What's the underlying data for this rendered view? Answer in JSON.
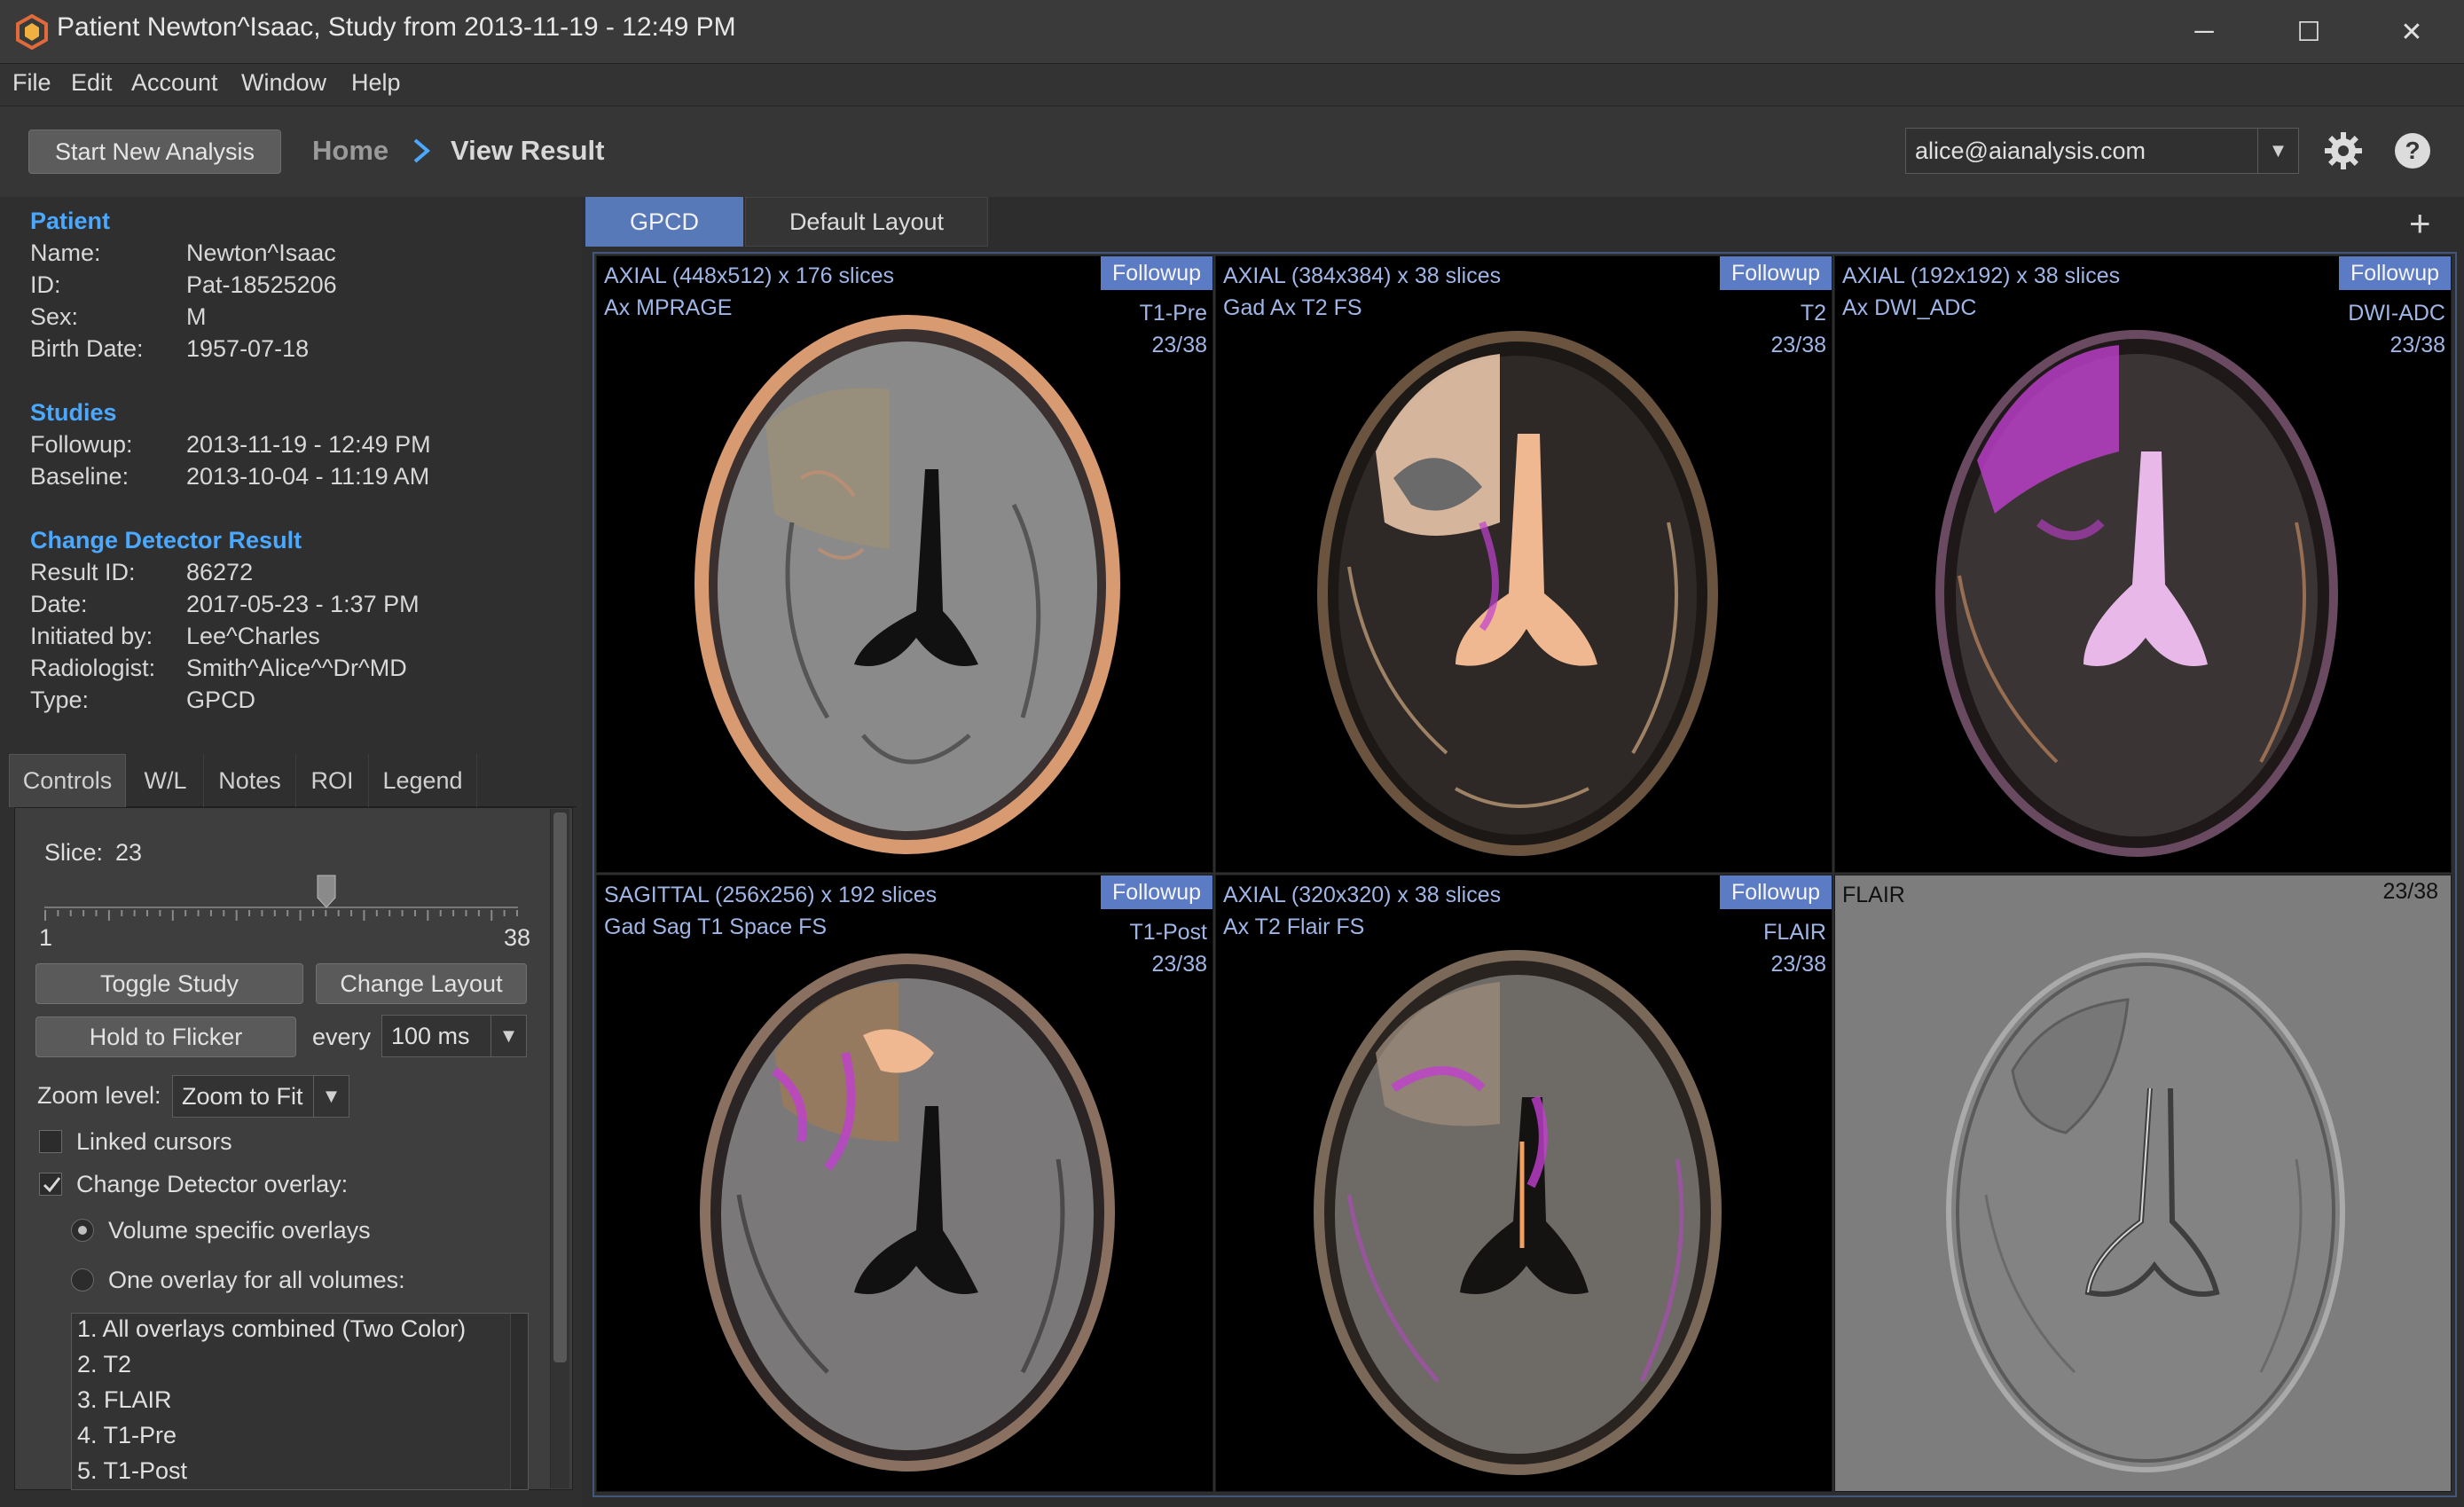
{
  "window": {
    "title": "Patient Newton^Isaac, Study from 2013-11-19 - 12:49 PM",
    "minimize": "─",
    "maximize": "☐",
    "close": "✕"
  },
  "menu": [
    "File",
    "Edit",
    "Account",
    "Window",
    "Help"
  ],
  "toolbar": {
    "start_label": "Start New Analysis",
    "breadcrumb": [
      "Home",
      "View Result"
    ],
    "user": "alice@aianalysis.com"
  },
  "patient": {
    "heading": "Patient",
    "fields": [
      {
        "k": "Name:",
        "v": "Newton^Isaac"
      },
      {
        "k": "ID:",
        "v": "Pat-18525206"
      },
      {
        "k": "Sex:",
        "v": "M"
      },
      {
        "k": "Birth Date:",
        "v": "1957-07-18"
      }
    ]
  },
  "studies": {
    "heading": "Studies",
    "fields": [
      {
        "k": "Followup:",
        "v": "2013-11-19 - 12:49 PM"
      },
      {
        "k": "Baseline:",
        "v": "2013-10-04 - 11:19 AM"
      }
    ]
  },
  "result": {
    "heading": "Change Detector Result",
    "fields": [
      {
        "k": "Result ID:",
        "v": "86272"
      },
      {
        "k": "Date:",
        "v": "2017-05-23 - 1:37 PM"
      },
      {
        "k": "Initiated by:",
        "v": "Lee^Charles"
      },
      {
        "k": "Radiologist:",
        "v": "Smith^Alice^^Dr^MD"
      },
      {
        "k": "Type:",
        "v": "GPCD"
      }
    ]
  },
  "control_tabs": [
    "Controls",
    "W/L",
    "Notes",
    "ROI",
    "Legend"
  ],
  "controls": {
    "slice_label": "Slice:",
    "slice_value": "23",
    "slice_min": "1",
    "slice_max": "38",
    "slice_fraction": 0.595,
    "toggle_study": "Toggle Study",
    "change_layout": "Change Layout",
    "hold_flicker": "Hold to Flicker",
    "every": "every",
    "interval": "100 ms",
    "zoom_label": "Zoom level:",
    "zoom_value": "Zoom to Fit",
    "linked_cursors": "Linked cursors",
    "linked_cursors_checked": false,
    "overlay_label": "Change Detector overlay:",
    "overlay_checked": true,
    "radio_volume": "Volume specific overlays",
    "radio_one": "One overlay for all volumes:",
    "overlay_list": [
      "1. All overlays combined (Two Color)",
      "2. T2",
      "3. FLAIR",
      "4. T1-Pre",
      "5. T1-Post"
    ]
  },
  "view_tabs": [
    "GPCD",
    "Default Layout"
  ],
  "add_tab": "+",
  "viewports": [
    {
      "line1": "AXIAL (448x512) x 176 slices",
      "line2": "Ax MPRAGE",
      "badge": "Followup",
      "seq": "T1-Pre",
      "slice": "23/38"
    },
    {
      "line1": "AXIAL (384x384) x 38 slices",
      "line2": "Gad Ax T2 FS",
      "badge": "Followup",
      "seq": "T2",
      "slice": "23/38"
    },
    {
      "line1": "AXIAL (192x192) x 38 slices",
      "line2": "Ax DWI_ADC",
      "badge": "Followup",
      "seq": "DWI-ADC",
      "slice": "23/38"
    },
    {
      "line1": "SAGITTAL (256x256) x 192 slices",
      "line2": "Gad Sag T1 Space FS",
      "badge": "Followup",
      "seq": "T1-Post",
      "slice": "23/38"
    },
    {
      "line1": "AXIAL (320x320) x 38 slices",
      "line2": "Ax T2 Flair FS",
      "badge": "Followup",
      "seq": "FLAIR",
      "slice": "23/38"
    },
    {
      "line1": "FLAIR",
      "slice": "23/38"
    }
  ],
  "colors": {
    "accent": "#4aa8ff",
    "tab_active": "#5879b8",
    "badge": "#5b7bc4",
    "overlay_text": "#9fb6e6",
    "overlay_magenta": "#c040d0",
    "overlay_orange": "#f0a060"
  }
}
